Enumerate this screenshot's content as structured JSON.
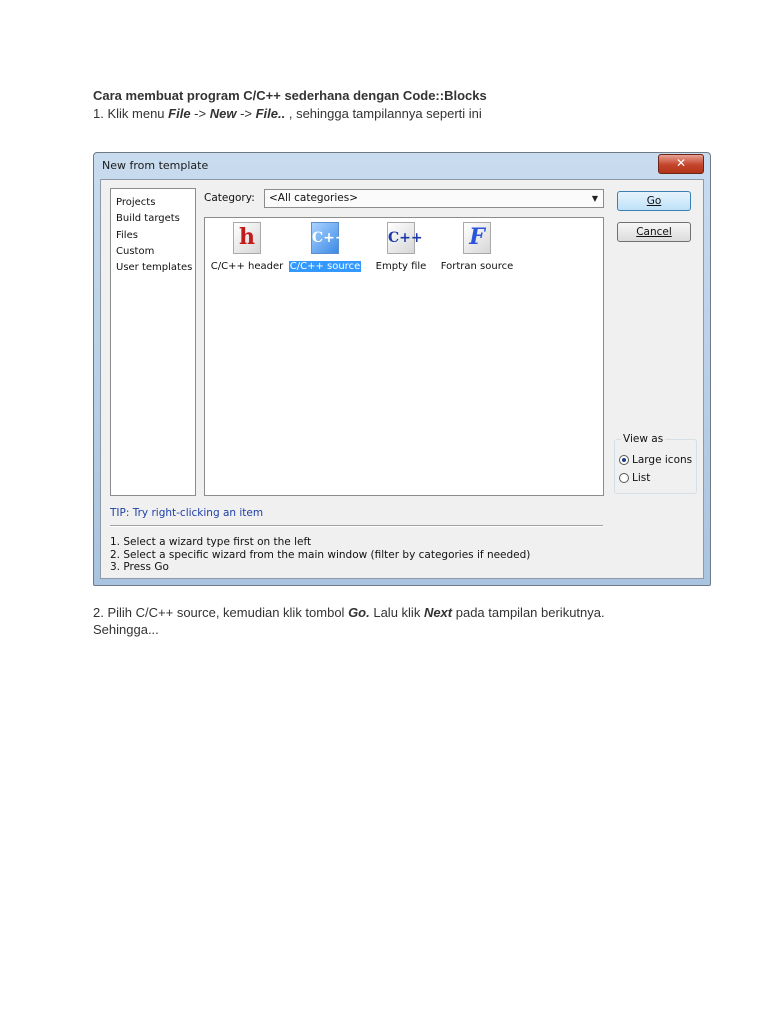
{
  "doc": {
    "title": "Cara membuat program C/C++ sederhana dengan Code::Blocks",
    "step1_prefix": "1. Klik menu ",
    "step1_file": "File",
    "step1_arrow1": " -> ",
    "step1_new": "New",
    "step1_arrow2": " -> ",
    "step1_file2": "File..",
    "step1_suffix": " , sehingga tampilannya seperti ini",
    "step2_prefix": "2. Pilih C/C++ source, kemudian klik tombol ",
    "step2_go": "Go.",
    "step2_mid": " Lalu klik ",
    "step2_next": "Next",
    "step2_suffix": " pada tampilan berikutnya.",
    "step2_line2": "Sehingga..."
  },
  "dialog": {
    "title": "New from template",
    "close_glyph": "✕",
    "left_items": [
      "Projects",
      "Build targets",
      "Files",
      "Custom",
      "User templates"
    ],
    "category_label": "Category:",
    "category_value": "<All categories>",
    "templates": [
      {
        "label": "C/C++ header",
        "glyph": "h",
        "selected": false
      },
      {
        "label": "C/C++ source",
        "glyph": "C++",
        "selected": true
      },
      {
        "label": "Empty file",
        "glyph": "C++",
        "selected": false
      },
      {
        "label": "Fortran source",
        "glyph": "F",
        "selected": false
      }
    ],
    "go_label": "Go",
    "cancel_label": "Cancel",
    "view_as_label": "View as",
    "large_icons_label": "Large icons",
    "list_label": "List",
    "tip": "TIP: Try right-clicking an item",
    "instructions": [
      "1. Select a wizard type first on the left",
      "2. Select a specific wizard from the main window (filter by categories if needed)",
      "3. Press Go"
    ]
  }
}
